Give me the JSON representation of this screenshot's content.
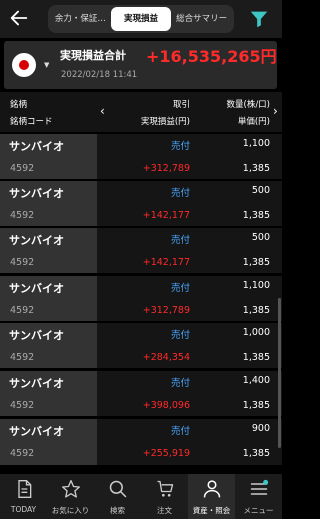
{
  "tabs": [
    {
      "label": "余力・保証…"
    },
    {
      "label": "実現損益"
    },
    {
      "label": "総合サマリー"
    }
  ],
  "summary": {
    "label": "実現損益合計",
    "value": "+16,535,265円",
    "date": "2022/02/18 11:41"
  },
  "header": {
    "col1_line1": "銘柄",
    "col1_line2": "銘柄コード",
    "col2_line1": "取引",
    "col2_line2": "実現損益(円)",
    "col3_line1": "数量(株/口)",
    "col3_line2": "単価(円)"
  },
  "rows": [
    {
      "name": "サンバイオ",
      "code": "4592",
      "side": "売付",
      "pl": "+312,789",
      "qty": "1,100",
      "price": "1,385"
    },
    {
      "name": "サンバイオ",
      "code": "4592",
      "side": "売付",
      "pl": "+142,177",
      "qty": "500",
      "price": "1,385"
    },
    {
      "name": "サンバイオ",
      "code": "4592",
      "side": "売付",
      "pl": "+142,177",
      "qty": "500",
      "price": "1,385"
    },
    {
      "name": "サンバイオ",
      "code": "4592",
      "side": "売付",
      "pl": "+312,789",
      "qty": "1,100",
      "price": "1,385"
    },
    {
      "name": "サンバイオ",
      "code": "4592",
      "side": "売付",
      "pl": "+284,354",
      "qty": "1,000",
      "price": "1,385"
    },
    {
      "name": "サンバイオ",
      "code": "4592",
      "side": "売付",
      "pl": "+398,096",
      "qty": "1,400",
      "price": "1,385"
    },
    {
      "name": "サンバイオ",
      "code": "4592",
      "side": "売付",
      "pl": "+255,919",
      "qty": "900",
      "price": "1,385"
    }
  ],
  "nav": [
    {
      "label": "TODAY",
      "icon": "document-icon"
    },
    {
      "label": "お気に入り",
      "icon": "star-icon"
    },
    {
      "label": "検索",
      "icon": "search-icon"
    },
    {
      "label": "注文",
      "icon": "cart-icon"
    },
    {
      "label": "資産・照会",
      "icon": "person-icon"
    },
    {
      "label": "メニュー",
      "icon": "menu-icon"
    }
  ],
  "colors": {
    "profit": "#ff2a2a",
    "sell": "#4aa7ff",
    "filter": "#3ec6c6"
  }
}
